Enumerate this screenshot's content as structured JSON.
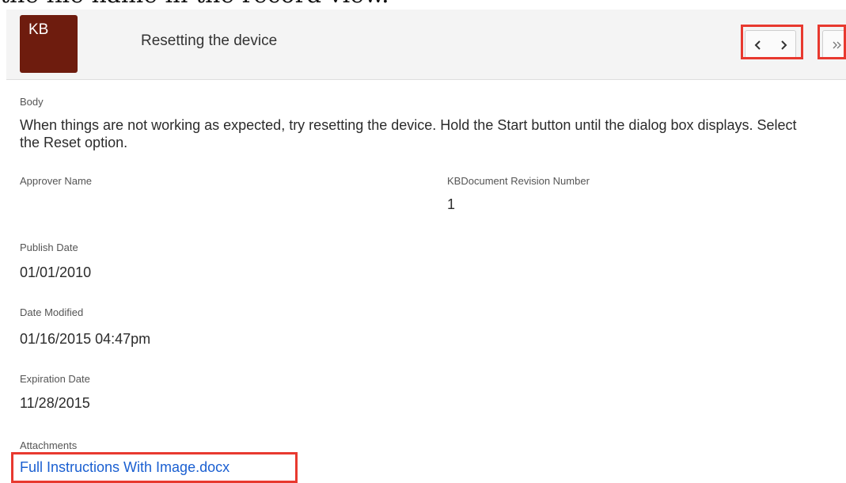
{
  "caption": "the file name in the record view.",
  "record": {
    "avatar_text": "KB",
    "title": "Resetting the device"
  },
  "icons": {
    "prev": "chevron-left-icon",
    "next": "chevron-right-icon",
    "expand": "double-chevron-right-icon"
  },
  "fields": {
    "body": {
      "label": "Body",
      "value": "When things are not working as expected, try resetting the device. Hold the Start button until the dialog box displays. Select the Reset option."
    },
    "approver_name": {
      "label": "Approver Name",
      "value": ""
    },
    "revision_number": {
      "label": "KBDocument Revision Number",
      "value": "1"
    },
    "publish_date": {
      "label": "Publish Date",
      "value": "01/01/2010"
    },
    "date_modified": {
      "label": "Date Modified",
      "value": "01/16/2015 04:47pm"
    },
    "expiration_date": {
      "label": "Expiration Date",
      "value": "11/28/2015"
    },
    "attachments": {
      "label": "Attachments",
      "value": "Full Instructions With Image.docx"
    }
  },
  "colors": {
    "avatar": "#6e1c0e",
    "highlight": "#e8392f",
    "link": "#1a5fd1"
  }
}
